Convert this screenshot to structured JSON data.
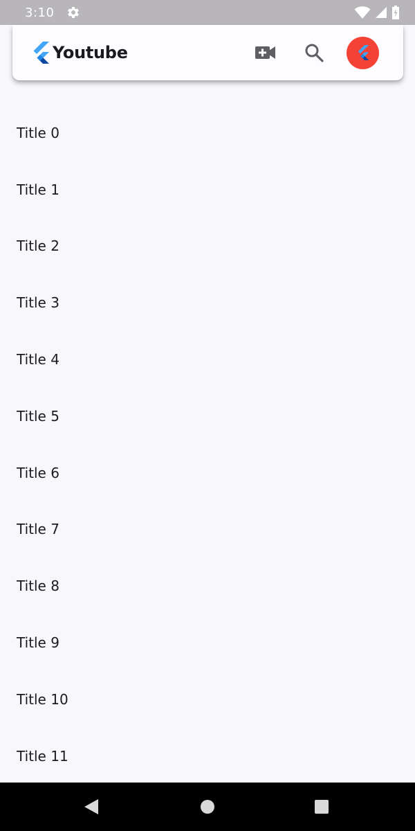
{
  "status_bar": {
    "time": "3:10",
    "icons": [
      "settings-gear-icon",
      "wifi-icon",
      "cell-signal-icon",
      "battery-charging-icon"
    ]
  },
  "app_bar": {
    "title": "Youtube",
    "logo_icon": "flutter-logo-icon",
    "actions": [
      "video-add-icon",
      "search-icon",
      "avatar"
    ],
    "avatar_color": "#f44336"
  },
  "list": {
    "items": [
      {
        "title": "Title 0"
      },
      {
        "title": "Title 1"
      },
      {
        "title": "Title 2"
      },
      {
        "title": "Title 3"
      },
      {
        "title": "Title 4"
      },
      {
        "title": "Title 5"
      },
      {
        "title": "Title 6"
      },
      {
        "title": "Title 7"
      },
      {
        "title": "Title 8"
      },
      {
        "title": "Title 9"
      },
      {
        "title": "Title 10"
      },
      {
        "title": "Title 11"
      }
    ]
  },
  "nav_bar": {
    "buttons": [
      "back-triangle-icon",
      "home-circle-icon",
      "recents-square-icon"
    ]
  }
}
